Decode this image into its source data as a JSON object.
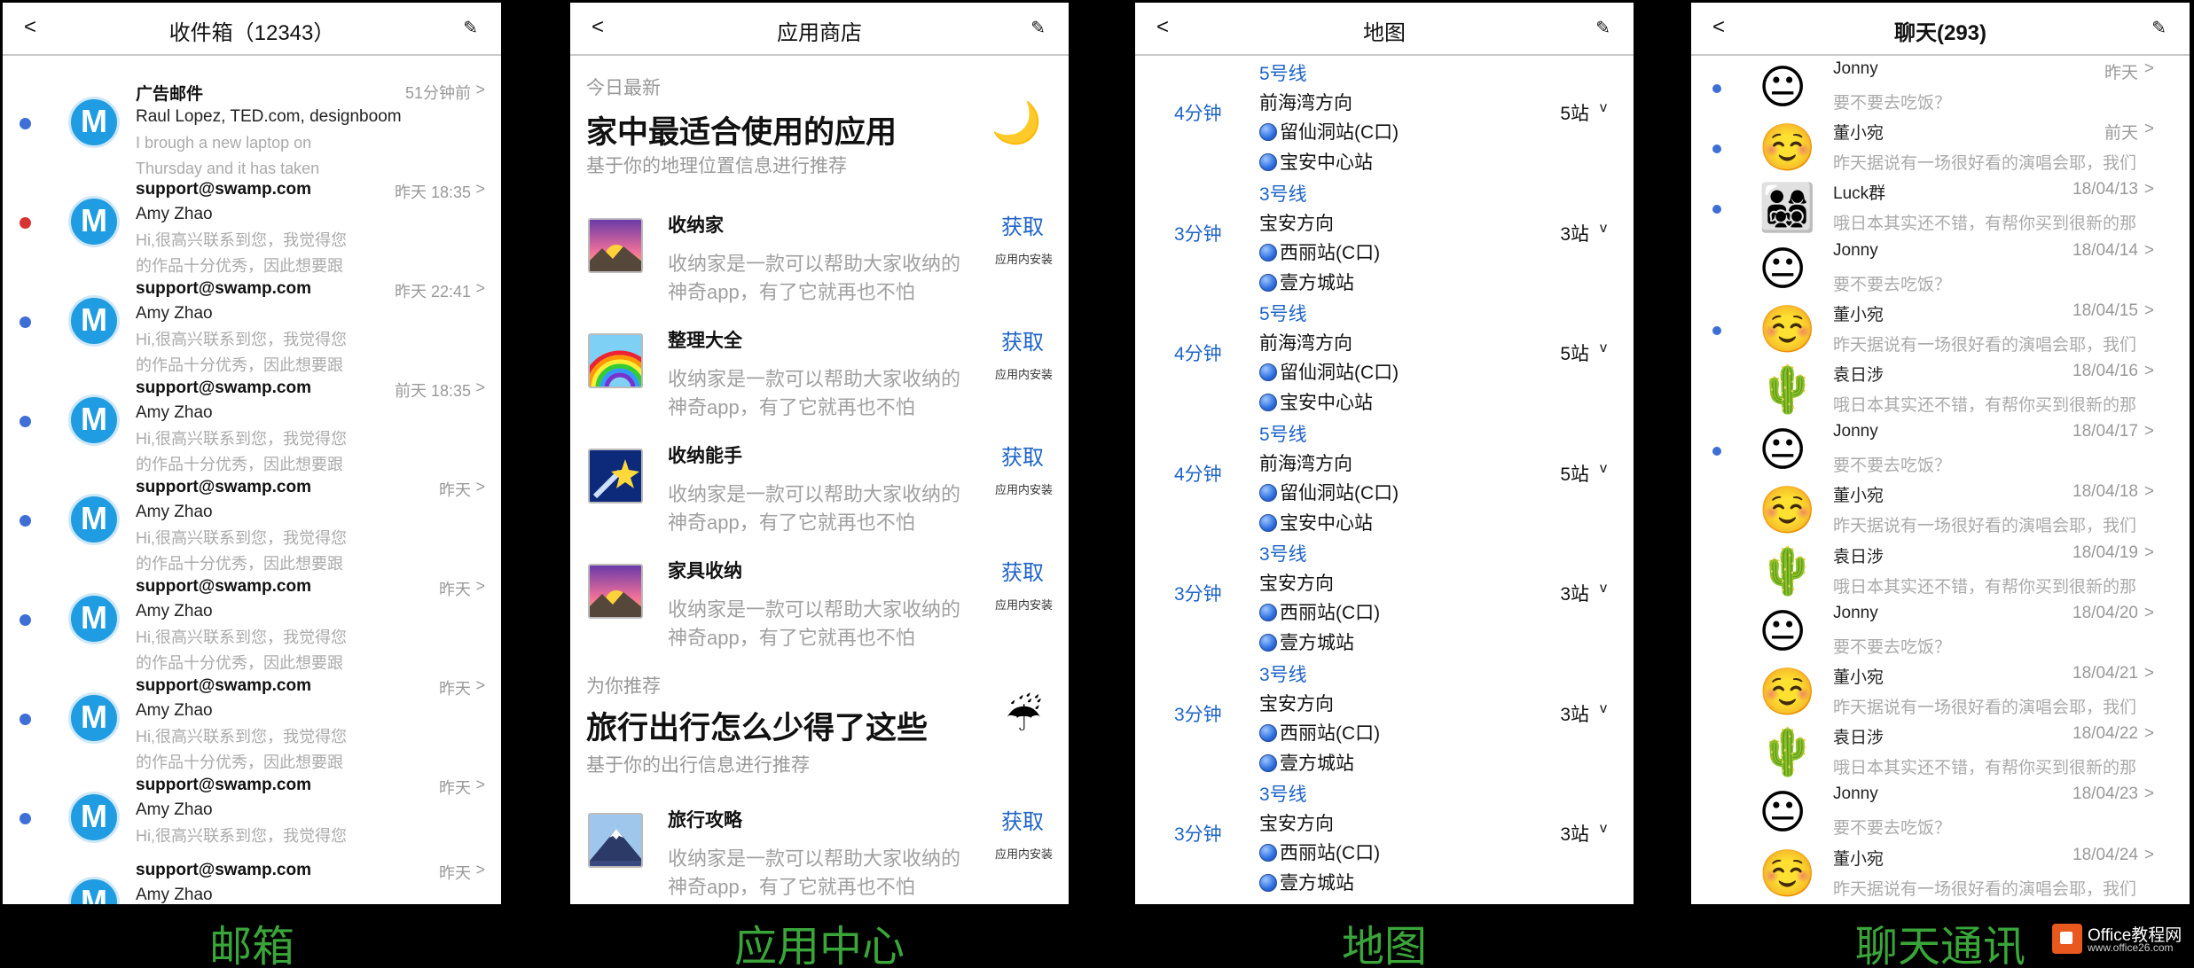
{
  "labels": {
    "mail": "邮箱",
    "app": "应用中心",
    "map": "地图",
    "chat": "聊天通讯"
  },
  "mail": {
    "title": "收件箱（12343）",
    "back": "<",
    "rows": [
      {
        "from": "广告邮件",
        "time": "51分钟前",
        "name": "Raul Lopez, TED.com, designboom",
        "snip1": "I brough a new laptop on",
        "snip2": "Thursday and it has taken",
        "dot": "blue"
      },
      {
        "from": "support@swamp.com",
        "time": "昨天 18:35",
        "name": "Amy Zhao",
        "snip1": "Hi,很高兴联系到您，我觉得您",
        "snip2": "的作品十分优秀，因此想要跟",
        "dot": "red"
      },
      {
        "from": "support@swamp.com",
        "time": "昨天 22:41",
        "name": "Amy Zhao",
        "snip1": "Hi,很高兴联系到您，我觉得您",
        "snip2": "的作品十分优秀，因此想要跟",
        "dot": "blue"
      },
      {
        "from": "support@swamp.com",
        "time": "前天 18:35",
        "name": "Amy Zhao",
        "snip1": "Hi,很高兴联系到您，我觉得您",
        "snip2": "的作品十分优秀，因此想要跟",
        "dot": "blue"
      },
      {
        "from": "support@swamp.com",
        "time": "昨天",
        "name": "Amy Zhao",
        "snip1": "Hi,很高兴联系到您，我觉得您",
        "snip2": "的作品十分优秀，因此想要跟",
        "dot": "blue"
      },
      {
        "from": "support@swamp.com",
        "time": "昨天",
        "name": "Amy Zhao",
        "snip1": "Hi,很高兴联系到您，我觉得您",
        "snip2": "的作品十分优秀，因此想要跟",
        "dot": "blue"
      },
      {
        "from": "support@swamp.com",
        "time": "昨天",
        "name": "Amy Zhao",
        "snip1": "Hi,很高兴联系到您，我觉得您",
        "snip2": "的作品十分优秀，因此想要跟",
        "dot": "blue"
      },
      {
        "from": "support@swamp.com",
        "time": "昨天",
        "name": "Amy Zhao",
        "snip1": "Hi,很高兴联系到您，我觉得您",
        "snip2": "",
        "dot": "blue"
      },
      {
        "from": "support@swamp.com",
        "time": "昨天",
        "name": "Amy Zhao",
        "snip1": "",
        "snip2": "",
        "dot": "none"
      }
    ]
  },
  "app": {
    "title": "应用商店",
    "back": "<",
    "section1": {
      "label": "今日最新",
      "title": "家中最适合使用的应用",
      "sub": "基于你的地理位置信息进行推荐",
      "emoji": "🌙"
    },
    "section2": {
      "label": "为你推荐",
      "title": "旅行出行怎么少得了这些",
      "sub": "基于你的出行信息进行推荐",
      "emoji": "☔"
    },
    "get": "获取",
    "note": "应用内安装",
    "apps": [
      {
        "name": "收纳家",
        "icon": "sunrise",
        "d1": "收纳家是一款可以帮助大家收纳的",
        "d2": "神奇app，有了它就再也不怕"
      },
      {
        "name": "整理大全",
        "icon": "rainbow",
        "d1": "收纳家是一款可以帮助大家收纳的",
        "d2": "神奇app，有了它就再也不怕"
      },
      {
        "name": "收纳能手",
        "icon": "shooting-star",
        "d1": "收纳家是一款可以帮助大家收纳的",
        "d2": "神奇app，有了它就再也不怕"
      },
      {
        "name": "家具收纳",
        "icon": "sunrise",
        "d1": "收纳家是一款可以帮助大家收纳的",
        "d2": "神奇app，有了它就再也不怕"
      },
      {
        "name": "旅行攻略",
        "icon": "mountain",
        "d1": "收纳家是一款可以帮助大家收纳的",
        "d2": "神奇app，有了它就再也不怕"
      }
    ]
  },
  "map": {
    "title": "地图",
    "back": "<",
    "routes": [
      {
        "line": "5号线",
        "min": "4分钟",
        "dir": "前海湾方向",
        "s1": "留仙洞站(C口)",
        "s2": "宝安中心站",
        "count": "5站"
      },
      {
        "line": "3号线",
        "min": "3分钟",
        "dir": "宝安方向",
        "s1": "西丽站(C口)",
        "s2": "壹方城站",
        "count": "3站"
      },
      {
        "line": "5号线",
        "min": "4分钟",
        "dir": "前海湾方向",
        "s1": "留仙洞站(C口)",
        "s2": "宝安中心站",
        "count": "5站"
      },
      {
        "line": "5号线",
        "min": "4分钟",
        "dir": "前海湾方向",
        "s1": "留仙洞站(C口)",
        "s2": "宝安中心站",
        "count": "5站"
      },
      {
        "line": "3号线",
        "min": "3分钟",
        "dir": "宝安方向",
        "s1": "西丽站(C口)",
        "s2": "壹方城站",
        "count": "3站"
      },
      {
        "line": "3号线",
        "min": "3分钟",
        "dir": "宝安方向",
        "s1": "西丽站(C口)",
        "s2": "壹方城站",
        "count": "3站"
      },
      {
        "line": "3号线",
        "min": "3分钟",
        "dir": "宝安方向",
        "s1": "西丽站(C口)",
        "s2": "壹方城站",
        "count": "3站"
      }
    ]
  },
  "chat": {
    "title": "聊天(293)",
    "back": "<",
    "rows": [
      {
        "name": "Jonny",
        "time": "昨天",
        "msg": "要不要去吃饭？",
        "av": "😐",
        "dot": true
      },
      {
        "name": "董小宛",
        "time": "前天",
        "msg": "昨天据说有一场很好看的演唱会耶，我们",
        "av": "☺️",
        "dot": true
      },
      {
        "name": "Luck群",
        "time": "18/04/13",
        "msg": "哦日本其实还不错，有帮你买到很新的那",
        "av": "👨‍👩‍👧‍👦",
        "dot": true
      },
      {
        "name": "Jonny",
        "time": "18/04/14",
        "msg": "要不要去吃饭？",
        "av": "😐",
        "dot": false
      },
      {
        "name": "董小宛",
        "time": "18/04/15",
        "msg": "昨天据说有一场很好看的演唱会耶，我们",
        "av": "☺️",
        "dot": true
      },
      {
        "name": "袁日涉",
        "time": "18/04/16",
        "msg": "哦日本其实还不错，有帮你买到很新的那",
        "av": "🌵",
        "dot": false
      },
      {
        "name": "Jonny",
        "time": "18/04/17",
        "msg": "要不要去吃饭？",
        "av": "😐",
        "dot": true
      },
      {
        "name": "董小宛",
        "time": "18/04/18",
        "msg": "昨天据说有一场很好看的演唱会耶，我们",
        "av": "☺️",
        "dot": false
      },
      {
        "name": "袁日涉",
        "time": "18/04/19",
        "msg": "哦日本其实还不错，有帮你买到很新的那",
        "av": "🌵",
        "dot": false
      },
      {
        "name": "Jonny",
        "time": "18/04/20",
        "msg": "要不要去吃饭？",
        "av": "😐",
        "dot": false
      },
      {
        "name": "董小宛",
        "time": "18/04/21",
        "msg": "昨天据说有一场很好看的演唱会耶，我们",
        "av": "☺️",
        "dot": false
      },
      {
        "name": "袁日涉",
        "time": "18/04/22",
        "msg": "哦日本其实还不错，有帮你买到很新的那",
        "av": "🌵",
        "dot": false
      },
      {
        "name": "Jonny",
        "time": "18/04/23",
        "msg": "要不要去吃饭？",
        "av": "😐",
        "dot": false
      },
      {
        "name": "董小宛",
        "time": "18/04/24",
        "msg": "昨天据说有一场很好看的演唱会耶，我们",
        "av": "☺️",
        "dot": false
      }
    ]
  },
  "watermark": {
    "line1": "Office教程网",
    "line2": "www.office26.com"
  },
  "icons": {
    "back": "chevron-left-icon",
    "edit": "pencil-icon",
    "chevron": ">",
    "expand": "v"
  },
  "colors": {
    "accent": "#1f64c7",
    "mail_avatar": "#1f9ce2",
    "label_green": "#3aa63a",
    "unread_dot": "#3d6fd6",
    "alert_dot": "#d83333"
  }
}
